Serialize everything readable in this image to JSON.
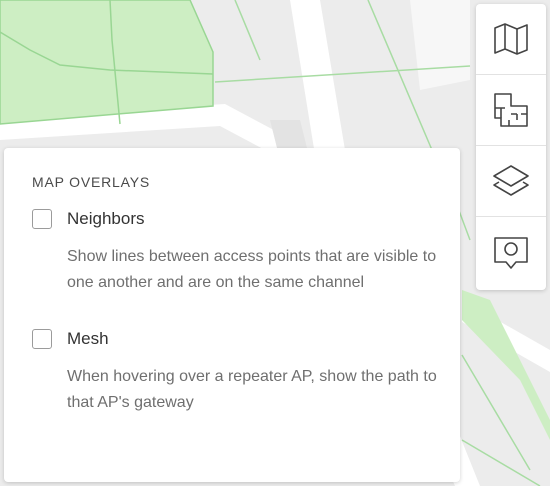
{
  "map_overlays": {
    "title": "MAP OVERLAYS",
    "options": [
      {
        "label": "Neighbors",
        "description": "Show lines between access points that are visible to one another and are on the same channel",
        "checked": false
      },
      {
        "label": "Mesh",
        "description": "When hovering over a repeater AP, show the path to that AP's gateway",
        "checked": false
      }
    ]
  },
  "toolbar": {
    "buttons": [
      {
        "icon": "map-icon"
      },
      {
        "icon": "floor-plan-icon"
      },
      {
        "icon": "layers-icon"
      },
      {
        "icon": "location-pin-icon"
      }
    ]
  },
  "colors": {
    "park_fill": "#cdeec3",
    "park_line": "#99d693",
    "road": "#ffffff",
    "background": "#eeeeee",
    "icon_stroke": "#444444"
  }
}
